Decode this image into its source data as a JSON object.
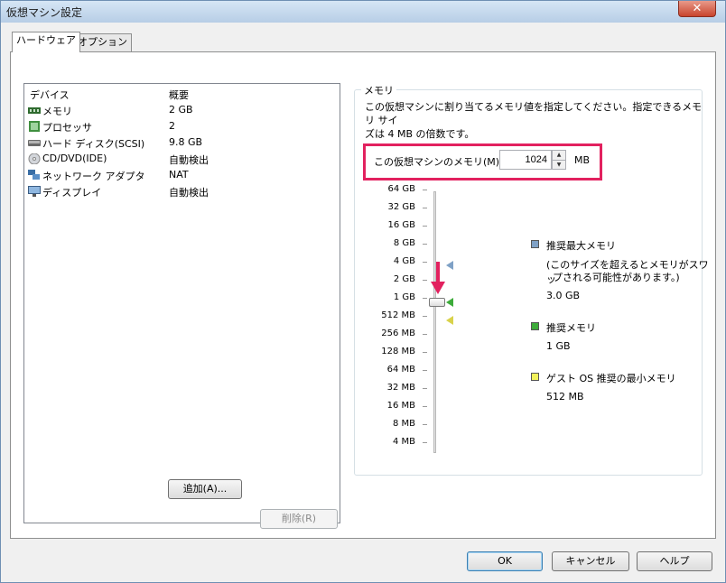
{
  "window": {
    "title": "仮想マシン設定",
    "close_label": "✕"
  },
  "tabs": [
    {
      "label": "ハードウェア",
      "active": true
    },
    {
      "label": "オプション",
      "active": false
    }
  ],
  "devices": {
    "col_device": "デバイス",
    "col_summary": "概要",
    "items": [
      {
        "name": "メモリ",
        "summary": "2 GB",
        "icon": "memory-icon"
      },
      {
        "name": "プロセッサ",
        "summary": "2",
        "icon": "processor-icon"
      },
      {
        "name": "ハード ディスク(SCSI)",
        "summary": "9.8 GB",
        "icon": "hard-disk-icon"
      },
      {
        "name": "CD/DVD(IDE)",
        "summary": "自動検出",
        "icon": "cd-dvd-icon"
      },
      {
        "name": "ネットワーク アダプタ",
        "summary": "NAT",
        "icon": "network-adapter-icon"
      },
      {
        "name": "ディスプレイ",
        "summary": "自動検出",
        "icon": "display-icon"
      }
    ],
    "add_button": "追加(A)...",
    "remove_button": "削除(R)"
  },
  "memory": {
    "group_title": "メモリ",
    "description_line1": "この仮想マシンに割り当てるメモリ値を指定してください。指定できるメモリ サイ",
    "description_line2": "ズは 4 MB の倍数です。",
    "field_label": "この仮想マシンのメモリ(M):",
    "value": "1024",
    "unit": "MB",
    "scale": [
      "64 GB",
      "32 GB",
      "16 GB",
      "8 GB",
      "4 GB",
      "2 GB",
      "1 GB",
      "512 MB",
      "256 MB",
      "128 MB",
      "64 MB",
      "32 MB",
      "16 MB",
      "8 MB",
      "4 MB"
    ],
    "legend": {
      "max_title": "推奨最大メモリ",
      "max_note_line1": "(このサイズを超えるとメモリがスワッ",
      "max_note_line2": "プされる可能性があります。)",
      "max_value": "3.0 GB",
      "rec_title": "推奨メモリ",
      "rec_value": "1 GB",
      "min_title": "ゲスト OS 推奨の最小メモリ",
      "min_value": "512 MB"
    },
    "colors": {
      "max": "#7fa1c6",
      "rec": "#3dab3a",
      "min": "#f2f25a",
      "highlight": "#e2215f"
    }
  },
  "buttons": {
    "ok": "OK",
    "cancel": "キャンセル",
    "help": "ヘルプ"
  }
}
